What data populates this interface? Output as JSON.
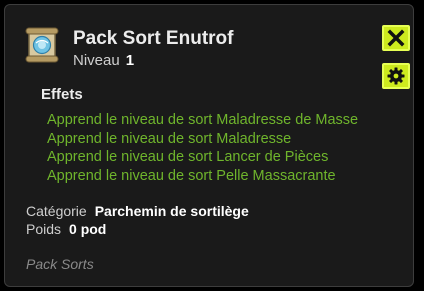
{
  "item": {
    "name": "Pack Sort Enutrof",
    "level_label": "Niveau",
    "level_value": "1",
    "icon": "scroll-icon"
  },
  "buttons": {
    "close_icon": "close-icon",
    "settings_icon": "gear-icon"
  },
  "colors": {
    "button_accent": "#cdea1e",
    "effect_text": "#6fb52c",
    "panel_bg": "#1a1a1a"
  },
  "effects": {
    "title": "Effets",
    "items": [
      "Apprend le niveau de sort Maladresse de Masse",
      "Apprend le niveau de sort Maladresse",
      "Apprend le niveau de sort Lancer de Pièces",
      "Apprend le niveau de sort Pelle Massacrante"
    ]
  },
  "properties": {
    "category_label": "Catégorie",
    "category_value": "Parchemin de sortilège",
    "weight_label": "Poids",
    "weight_value": "0 pod"
  },
  "footer": {
    "type": "Pack Sorts"
  }
}
